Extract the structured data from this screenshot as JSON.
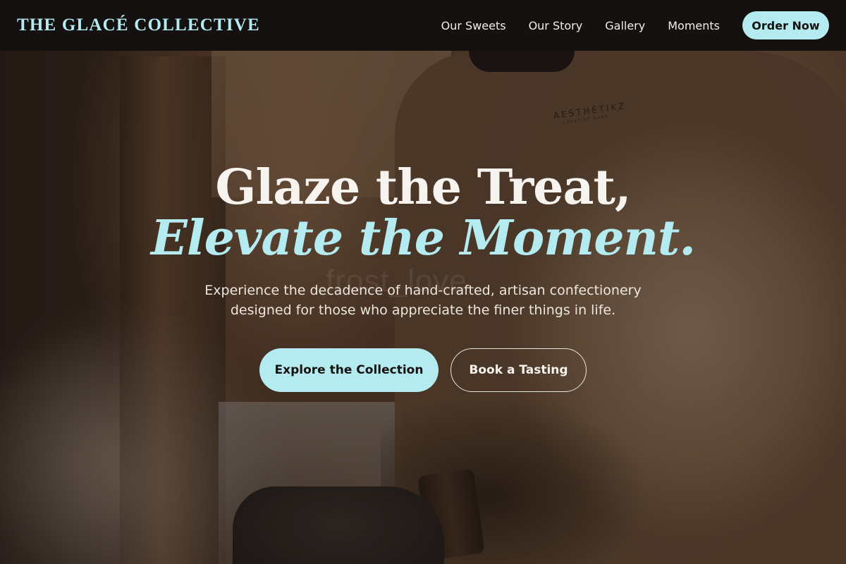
{
  "nav": {
    "logo": "THE GLACÉ COLLECTIVE",
    "links": [
      "Our Sweets",
      "Our Story",
      "Gallery",
      "Moments"
    ],
    "cta": "Order Now"
  },
  "hero": {
    "headline_line1": "Glaze the Treat,",
    "headline_line2": "Elevate the Moment.",
    "subtext": "Experience the decadence of hand-crafted, artisan confectionery designed for those who appreciate the finer things in life.",
    "primary_button": "Explore the Collection",
    "secondary_button": "Book a Tasting",
    "watermark": "frost_love",
    "image_brand_print": "AESTHÉTIKZ"
  },
  "colors": {
    "accent": "#b4ebf0",
    "nav_background": "#141110",
    "text_light": "#f7f3ee"
  }
}
